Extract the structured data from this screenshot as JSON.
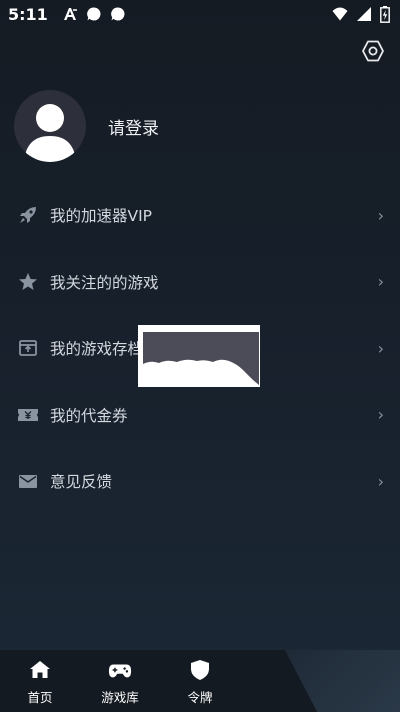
{
  "status_bar": {
    "time": "5:11",
    "left_icons": [
      "font-a-icon",
      "chat-bubble-icon",
      "chat-bubble-icon"
    ],
    "right_icons": [
      "wifi-icon",
      "signal-icon",
      "battery-icon"
    ]
  },
  "header": {
    "settings_icon": "hex-gear-icon"
  },
  "profile": {
    "login_text": "请登录",
    "avatar_icon": "default-avatar"
  },
  "menu": {
    "items": [
      {
        "label": "我的加速器VIP",
        "icon": "rocket-icon"
      },
      {
        "label": "我关注的的游戏",
        "icon": "star-icon"
      },
      {
        "label": "我的游戏存档",
        "icon": "archive-icon"
      },
      {
        "label": "我的代金券",
        "icon": "coupon-icon"
      },
      {
        "label": "意见反馈",
        "icon": "mail-icon"
      }
    ],
    "chevron": "›"
  },
  "bottom_nav": {
    "items": [
      {
        "label": "首页",
        "icon": "home-icon"
      },
      {
        "label": "游戏库",
        "icon": "gamepad-icon"
      },
      {
        "label": "令牌",
        "icon": "shield-icon"
      }
    ]
  },
  "colors": {
    "background_top": "#151b23",
    "background_bottom": "#1c2836",
    "menu_text": "#d3d7de",
    "icon": "#8a93a0",
    "nav_bar": "#141a21"
  }
}
